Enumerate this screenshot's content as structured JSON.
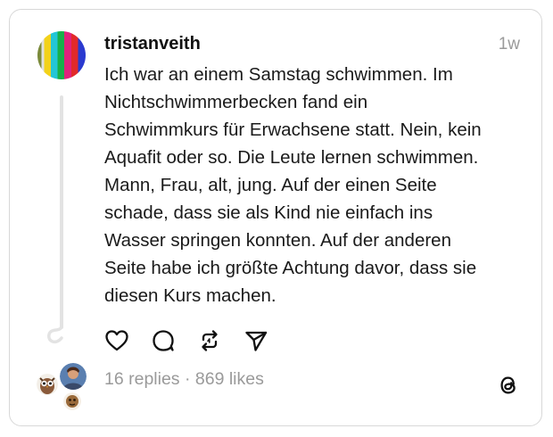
{
  "post": {
    "username": "tristanveith",
    "time": "1w",
    "text": "Ich war an einem Samstag schwimmen. Im\nNichtschwimmerbecken fand ein\nSchwimmkurs für Erwachsene statt. Nein, kein\nAquafit oder so. Die Leute lernen schwimmen.\nMann, Frau, alt, jung. Auf der einen Seite\nschade, dass sie als Kind nie einfach ins\nWasser springen konnten. Auf der anderen\nSeite habe ich größte Achtung davor, dass sie\ndiesen Kurs machen.",
    "stats": "16 replies · 869 likes"
  },
  "actions": {
    "icons": [
      "heart-icon",
      "comment-icon",
      "repost-icon",
      "share-icon"
    ]
  },
  "colors": {
    "text": "#1a1a1a",
    "muted": "#9a9a9a",
    "border": "#d8d8d8",
    "thread_line": "#e3e3e3"
  }
}
